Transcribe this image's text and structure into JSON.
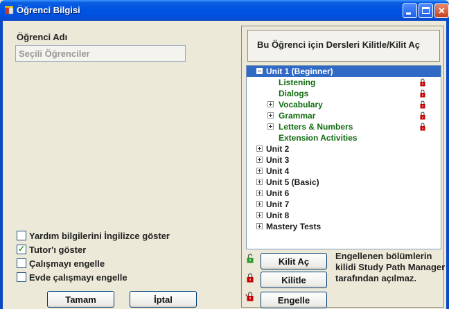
{
  "window": {
    "title": "Öğrenci Bilgisi"
  },
  "left": {
    "name_label": "Öğrenci Adı",
    "name_input_value": "Seçili Öğrenciler",
    "options": [
      {
        "label": "Yardım bilgilerini İngilizce göster",
        "checked": false
      },
      {
        "label": "Tutor'ı göster",
        "checked": true
      },
      {
        "label": "Çalışmayı engelle",
        "checked": false
      },
      {
        "label": "Evde çalışmayı engelle",
        "checked": false
      }
    ],
    "ok_button": "Tamam",
    "cancel_button": "İptal"
  },
  "right": {
    "header": "Bu Öğrenci için Dersleri Kilitle/Kilit Aç",
    "tree": [
      {
        "label": "Unit 1 (Beginner)",
        "expander": "minus",
        "selected": true,
        "locked": false
      },
      {
        "label": "Listening",
        "expander": "none",
        "selected": false,
        "locked": true
      },
      {
        "label": "Dialogs",
        "expander": "none",
        "selected": false,
        "locked": true
      },
      {
        "label": "Vocabulary",
        "expander": "plus",
        "selected": false,
        "locked": true
      },
      {
        "label": "Grammar",
        "expander": "plus",
        "selected": false,
        "locked": true
      },
      {
        "label": "Letters & Numbers",
        "expander": "plus",
        "selected": false,
        "locked": true
      },
      {
        "label": "Extension Activities",
        "expander": "none",
        "selected": false,
        "locked": false
      },
      {
        "label": "Unit 2",
        "expander": "plus",
        "selected": false,
        "locked": false
      },
      {
        "label": "Unit 3",
        "expander": "plus",
        "selected": false,
        "locked": false
      },
      {
        "label": "Unit 4",
        "expander": "plus",
        "selected": false,
        "locked": false
      },
      {
        "label": "Unit 5 (Basic)",
        "expander": "plus",
        "selected": false,
        "locked": false
      },
      {
        "label": "Unit 6",
        "expander": "plus",
        "selected": false,
        "locked": false
      },
      {
        "label": "Unit 7",
        "expander": "plus",
        "selected": false,
        "locked": false
      },
      {
        "label": "Unit 8",
        "expander": "plus",
        "selected": false,
        "locked": false
      },
      {
        "label": "Mastery Tests",
        "expander": "plus",
        "selected": false,
        "locked": false
      }
    ],
    "unlock_button": "Kilit Aç",
    "lock_button": "Kilitle",
    "block_button": "Engelle",
    "note": "Engellenen bölümlerin kilidi Study Path Manager tarafından açılmaz."
  },
  "icons": {
    "unlocked_lock": "lock-open-green-icon",
    "locked_lock": "lock-red-icon",
    "blocked_lock": "lock-blocked-icon"
  },
  "colors": {
    "title_bar": "#0054e3",
    "selection": "#316ac5",
    "lesson_text": "#0f6b0f",
    "lock_red": "#c40000",
    "lock_green": "#2a9a2a"
  }
}
